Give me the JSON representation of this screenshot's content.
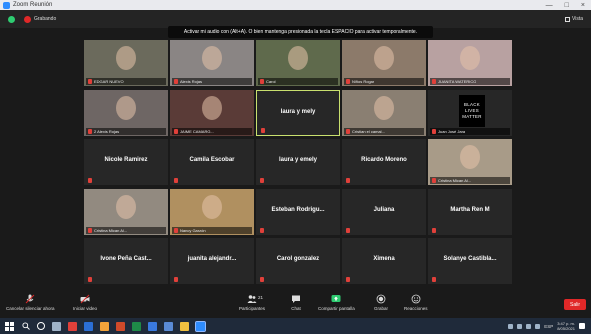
{
  "window": {
    "title": "Zoom Reunión",
    "controls": [
      "—",
      "□",
      "×"
    ]
  },
  "topbar": {
    "recording_label": "Grabando",
    "view_label": "Vista"
  },
  "tooltip": "Activar mi audio con (Alt+A). O bien mantenga presionada la tecla ESPACIO para activar temporalmente.",
  "gallery": {
    "tiles": [
      {
        "name": "EDGAR NUEVO",
        "video": true,
        "bg": "#6b6a5c"
      },
      {
        "name": "Alexis Rojas",
        "video": true,
        "bg": "#8a8584"
      },
      {
        "name": "Carol",
        "video": true,
        "bg": "#5f6a4c"
      },
      {
        "name": "Niños Rogar",
        "video": true,
        "bg": "#8c7a6a"
      },
      {
        "name": "JUANITA WATERICO",
        "video": true,
        "bg": "#b8a1a1"
      },
      {
        "name": "2 Alexis Rojas",
        "video": true,
        "bg": "#6e6664"
      },
      {
        "name": "JAIME CAMARG...",
        "video": true,
        "bg": "#5a3b37"
      },
      {
        "name": "laura y mely",
        "video": false,
        "bg": "#1c1c1c",
        "active": true
      },
      {
        "name": "Cristian el camal...",
        "video": true,
        "bg": "#8a7f72"
      },
      {
        "name": "Juan José Jara",
        "video": true,
        "bg": "#272727",
        "blm": true
      },
      {
        "name": "Nicole Ramirez",
        "video": false
      },
      {
        "name": "Camila Escobar",
        "video": false
      },
      {
        "name": "laura y emely",
        "video": false
      },
      {
        "name": "Ricardo Moreno",
        "video": false
      },
      {
        "name": "Cristina Mican Al...",
        "video": true,
        "bg": "#a89b88"
      },
      {
        "name": "Cristina Mican Al...",
        "video": true,
        "bg": "#928a80"
      },
      {
        "name": "Nancy Garzón",
        "video": true,
        "bg": "#b09060"
      },
      {
        "name": "Esteban Rodrigu...",
        "video": false
      },
      {
        "name": "Juliana",
        "video": false
      },
      {
        "name": "Martha Ren M",
        "video": false
      },
      {
        "name": "Ivone Peña Cast...",
        "video": false
      },
      {
        "name": "juanita alejandr...",
        "video": false
      },
      {
        "name": "Carol gonzalez",
        "video": false
      },
      {
        "name": "Ximena",
        "video": false
      },
      {
        "name": "Solanye Castibla...",
        "video": false
      }
    ],
    "blm_text": [
      "BLACK",
      "LIVES",
      "MATTER"
    ]
  },
  "toolbar": {
    "items": [
      {
        "label": "Cancelar silenciar ahora",
        "icon": "microphone-icon"
      },
      {
        "label": "Iniciar video",
        "icon": "video-camera-icon"
      },
      {
        "label": "Participantes",
        "icon": "participants-icon",
        "count": "21"
      },
      {
        "label": "Chat",
        "icon": "chat-icon"
      },
      {
        "label": "Compartir pantalla",
        "icon": "share-screen-icon"
      },
      {
        "label": "Grabar",
        "icon": "record-icon"
      },
      {
        "label": "Reacciones",
        "icon": "reactions-icon"
      }
    ],
    "leave_label": "Salir"
  },
  "taskbar": {
    "lang": "ESP",
    "time": "3:47 p. m.",
    "date": "8/05/2021",
    "colors": {
      "accent": "#2d8cff",
      "record": "#e02828",
      "share": "#2ecc71"
    }
  }
}
